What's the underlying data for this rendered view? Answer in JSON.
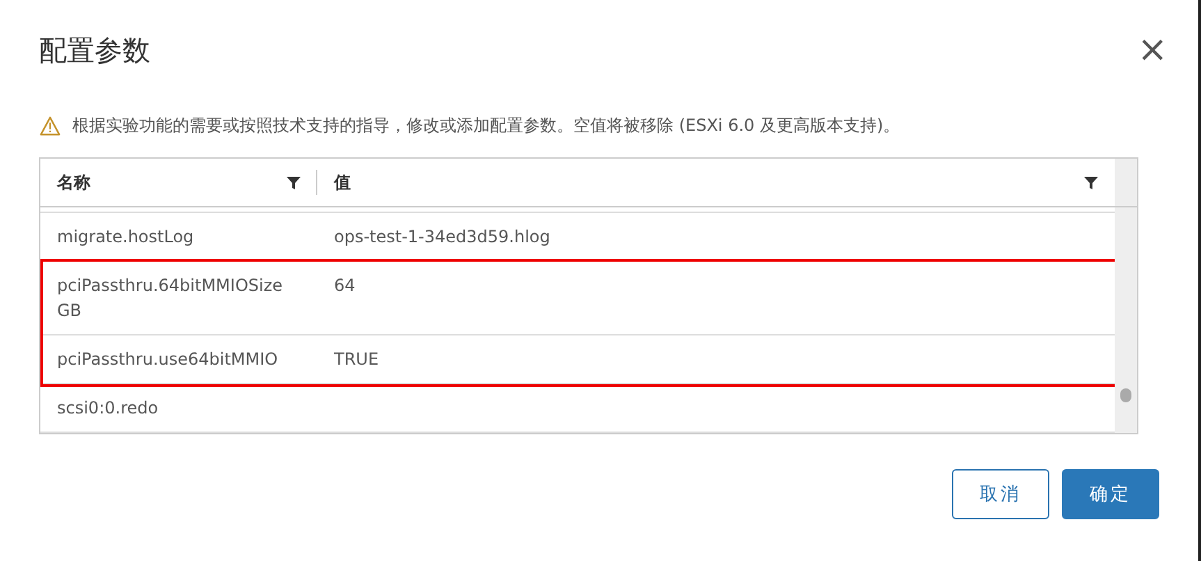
{
  "dialog": {
    "title": "配置参数",
    "close": "×"
  },
  "notice": "根据实验功能的需要或按照技术支持的指导，修改或添加配置参数。空值将被移除 (ESXi 6.0 及更高版本支持)。",
  "table": {
    "columns": [
      "名称",
      "值"
    ],
    "rows": [
      {
        "name": "migrate.hostLog",
        "value": "ops-test-1-34ed3d59.hlog",
        "highlighted": false
      },
      {
        "name": "pciPassthru.64bitMMIOSize GB",
        "value": "64",
        "highlighted": true
      },
      {
        "name": "pciPassthru.use64bitMMIO",
        "value": "TRUE",
        "highlighted": true
      },
      {
        "name": "scsi0:0.redo",
        "highlighted": false
      }
    ]
  },
  "buttons": [
    {
      "label": "取消",
      "kind": "secondary"
    },
    {
      "label": "确定",
      "kind": "primary"
    }
  ]
}
